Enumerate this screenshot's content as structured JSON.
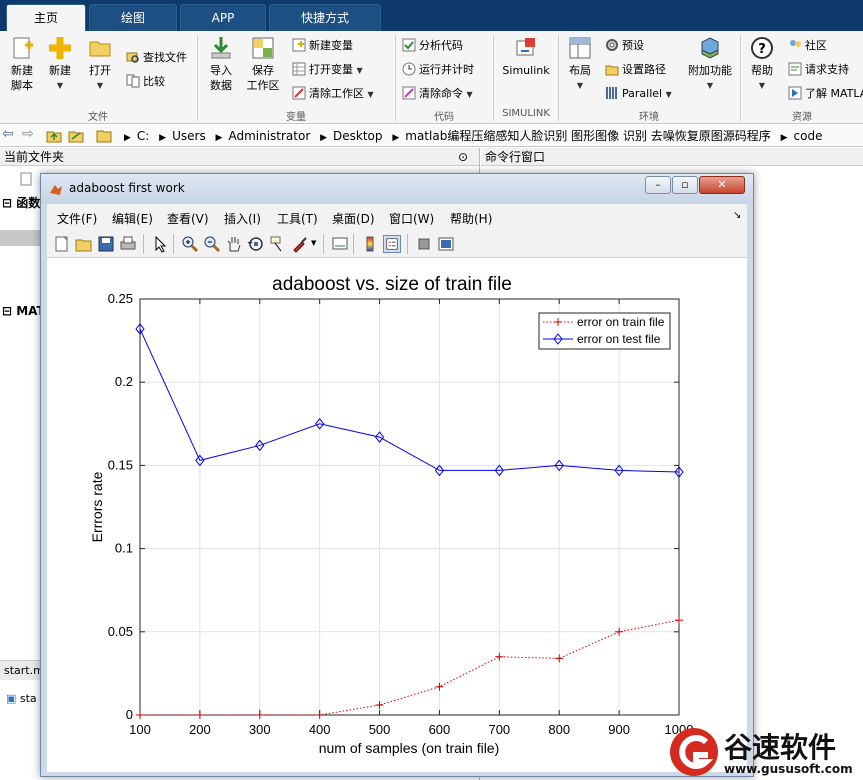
{
  "ribbon": {
    "tabs": [
      "主页",
      "绘图",
      "APP",
      "快捷方式"
    ],
    "groups": {
      "file": "文件",
      "variable": "变量",
      "code": "代码",
      "simulink": "SIMULINK",
      "env": "环境",
      "resources": "资源"
    },
    "buttons": {
      "new_script_1": "新建",
      "new_script_2": "脚本",
      "new": "新建",
      "open": "打开",
      "find_files": "查找文件",
      "compare": "比较",
      "import_1": "导入",
      "import_2": "数据",
      "save_ws_1": "保存",
      "save_ws_2": "工作区",
      "new_var": "新建变量",
      "open_var": "打开变量",
      "clear_ws": "清除工作区",
      "analyze_code": "分析代码",
      "run_time": "运行并计时",
      "clear_cmd": "清除命令",
      "simulink": "Simulink",
      "layout": "布局",
      "preferences": "预设",
      "set_path": "设置路径",
      "parallel": "Parallel",
      "addons": "附加功能",
      "help": "帮助",
      "community": "社区",
      "request_support": "请求支持",
      "learn_matlab": "了解 MATLAB"
    }
  },
  "address": {
    "parts": [
      "C:",
      "Users",
      "Administrator",
      "Desktop",
      "matlab编程压缩感知人脸识别 图形图像 识别 去噪恢复原图源码程序",
      "code"
    ]
  },
  "panels": {
    "current_folder": "当前文件夹",
    "command_window": "命令行窗口",
    "func_label": "函数",
    "matlab_label": "MATL",
    "start_tab": "start.m",
    "start_item": "sta"
  },
  "figure": {
    "title": "adaboost first work",
    "menu": [
      "文件(F)",
      "编辑(E)",
      "查看(V)",
      "插入(I)",
      "工具(T)",
      "桌面(D)",
      "窗口(W)",
      "帮助(H)"
    ]
  },
  "colors": {
    "train": "#cc0000",
    "test": "#0000ee"
  },
  "chart_data": {
    "type": "line",
    "title": "adaboost vs. size of train file",
    "xlabel": "num of samples (on train file)",
    "ylabel": "Errrors rate",
    "x": [
      100,
      200,
      300,
      400,
      500,
      600,
      700,
      800,
      900,
      1000
    ],
    "xlim": [
      100,
      1000
    ],
    "ylim": [
      0,
      0.25
    ],
    "xticks": [
      "100",
      "200",
      "300",
      "400",
      "500",
      "600",
      "700",
      "800",
      "900",
      "1000"
    ],
    "yticks": [
      "0",
      "0.05",
      "0.1",
      "0.15",
      "0.2",
      "0.25"
    ],
    "grid": true,
    "legend_position": "top-right",
    "series": [
      {
        "name": "error on train file",
        "style": "dotted",
        "marker": "+",
        "values": [
          0,
          0,
          0,
          0,
          0.006,
          0.017,
          0.035,
          0.034,
          0.05,
          0.057
        ]
      },
      {
        "name": "error on test file",
        "style": "solid",
        "marker": "diamond",
        "values": [
          0.232,
          0.153,
          0.162,
          0.175,
          0.167,
          0.147,
          0.147,
          0.15,
          0.147,
          0.146
        ]
      }
    ]
  },
  "watermark": {
    "brand": "谷速软件",
    "url": "www.gususoft.com"
  }
}
